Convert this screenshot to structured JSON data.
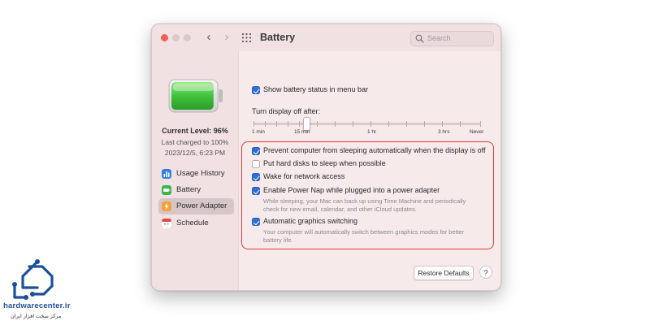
{
  "window": {
    "title": "Battery",
    "nav_back": "‹",
    "nav_forward": "›",
    "search_placeholder": "Search"
  },
  "status": {
    "current_level": "Current Level: 96%",
    "last_charged": "Last charged to 100%",
    "charged_date": "2023/12/5, 6:23 PM",
    "battery_level": 0.96,
    "battery_color": "#3fc23a"
  },
  "sidebar": {
    "items": [
      {
        "label": "Usage History",
        "icon": "usage-history-icon",
        "color": "#2f7fe0",
        "selected": false
      },
      {
        "label": "Battery",
        "icon": "battery-icon",
        "color": "#39b54a",
        "selected": false
      },
      {
        "label": "Power Adapter",
        "icon": "power-adapter-icon",
        "color": "#f2a23a",
        "selected": true
      },
      {
        "label": "Schedule",
        "icon": "calendar-icon",
        "color": "#e04a4a",
        "selected": false
      }
    ]
  },
  "main": {
    "show_status": {
      "label": "Show battery status in menu bar",
      "checked": true
    },
    "slider": {
      "label": "Turn display off after:",
      "value": "15 min",
      "ticks": [
        "1 min",
        "15 min",
        "1 hr",
        "3 hrs",
        "Never"
      ]
    },
    "options": [
      {
        "label": "Prevent computer from sleeping automatically when the display is off",
        "checked": true
      },
      {
        "label": "Put hard disks to sleep when possible",
        "checked": false
      },
      {
        "label": "Wake for network access",
        "checked": true
      },
      {
        "label": "Enable Power Nap while plugged into a power adapter",
        "checked": true,
        "description": "While sleeping, your Mac can back up using Time Machine and periodically check for new email, calendar, and other iCloud updates."
      },
      {
        "label": "Automatic graphics switching",
        "checked": true,
        "description": "Your computer will automatically switch between graphics modes for better battery life."
      }
    ],
    "restore_label": "Restore Defaults",
    "help_label": "?",
    "highlight_color": "#e23a3a"
  },
  "watermark": {
    "brand": "hardwarecenter.ir",
    "tagline": "مرکز سخت افزار ایران",
    "brand_color": "#1e4f9a"
  }
}
